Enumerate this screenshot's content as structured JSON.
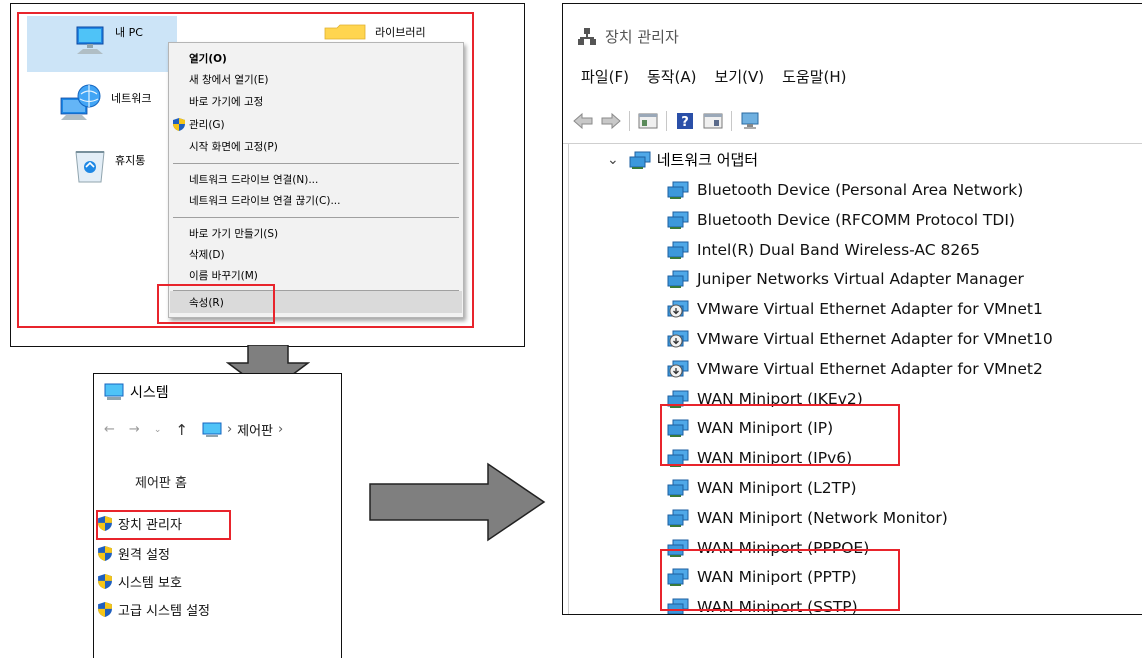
{
  "explorer": {
    "items": [
      {
        "label": "내 PC",
        "icon": "pc-icon"
      },
      {
        "label": "라이브러리",
        "icon": "folder-icon"
      },
      {
        "label": "네트워크",
        "icon": "network-icon"
      },
      {
        "label": "휴지통",
        "icon": "recycle-bin-icon"
      }
    ],
    "context_menu": [
      {
        "label": "열기(O)"
      },
      {
        "label": "새 창에서 열기(E)"
      },
      {
        "label": "바로 가기에 고정"
      },
      {
        "label": "관리(G)"
      },
      {
        "label": "시작 화면에 고정(P)"
      },
      {
        "label": "네트워크 드라이브 연결(N)..."
      },
      {
        "label": "네트워크 드라이브 연결 끊기(C)..."
      },
      {
        "label": "바로 가기 만들기(S)"
      },
      {
        "label": "삭제(D)"
      },
      {
        "label": "이름 바꾸기(M)"
      },
      {
        "label": "속성(R)"
      }
    ]
  },
  "system": {
    "title": "시스템",
    "breadcrumb": "제어판",
    "home_link": "제어판 홈",
    "links": [
      {
        "label": "장치 관리자"
      },
      {
        "label": "원격 설정"
      },
      {
        "label": "시스템 보호"
      },
      {
        "label": "고급 시스템 설정"
      }
    ]
  },
  "device_manager": {
    "title": "장치 관리자",
    "menu": [
      "파일(F)",
      "동작(A)",
      "보기(V)",
      "도움말(H)"
    ],
    "category": "네트워크 어댑터",
    "devices": [
      {
        "label": "Bluetooth Device (Personal Area Network)",
        "icon": "network-adapter-icon"
      },
      {
        "label": "Bluetooth Device (RFCOMM Protocol TDI)",
        "icon": "network-adapter-icon"
      },
      {
        "label": "Intel(R) Dual Band Wireless-AC 8265",
        "icon": "network-adapter-icon"
      },
      {
        "label": "Juniper Networks Virtual Adapter Manager",
        "icon": "network-adapter-icon"
      },
      {
        "label": "VMware Virtual Ethernet Adapter for VMnet1",
        "icon": "disabled-adapter-icon"
      },
      {
        "label": "VMware Virtual Ethernet Adapter for VMnet10",
        "icon": "disabled-adapter-icon"
      },
      {
        "label": "VMware Virtual Ethernet Adapter for VMnet2",
        "icon": "disabled-adapter-icon"
      },
      {
        "label": "WAN Miniport (IKEv2)",
        "icon": "network-adapter-icon"
      },
      {
        "label": "WAN Miniport (IP)",
        "icon": "network-adapter-icon"
      },
      {
        "label": "WAN Miniport (IPv6)",
        "icon": "network-adapter-icon"
      },
      {
        "label": "WAN Miniport (L2TP)",
        "icon": "network-adapter-icon"
      },
      {
        "label": "WAN Miniport (Network Monitor)",
        "icon": "network-adapter-icon"
      },
      {
        "label": "WAN Miniport (PPPOE)",
        "icon": "network-adapter-icon"
      },
      {
        "label": "WAN Miniport (PPTP)",
        "icon": "network-adapter-icon"
      },
      {
        "label": "WAN Miniport (SSTP)",
        "icon": "network-adapter-icon"
      }
    ]
  },
  "colors": {
    "highlight_red": "#e8242c",
    "selection_blue": "#cce4f7",
    "arrow_gray": "#7f7f7f"
  }
}
